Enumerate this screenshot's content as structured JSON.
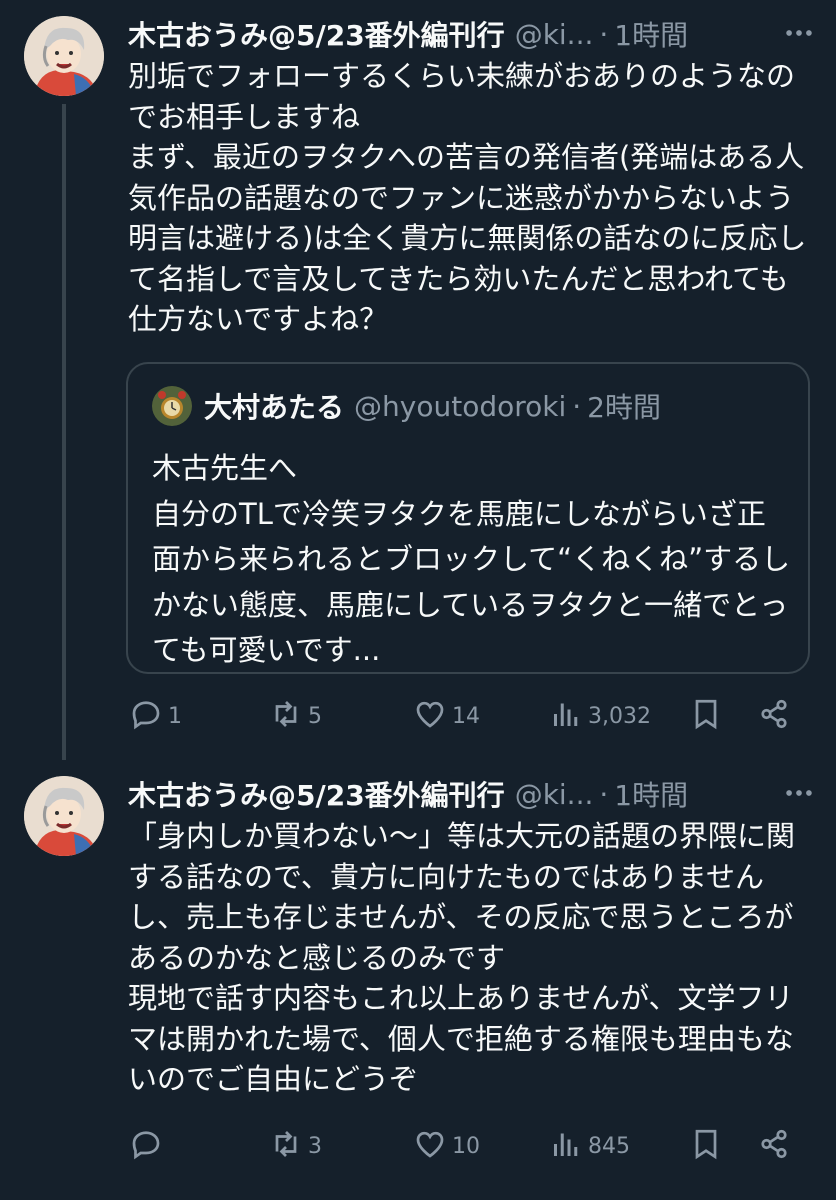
{
  "tweets": [
    {
      "author": {
        "display_name": "木古おうみ@5/23番外編刊行",
        "handle": "@ki...",
        "time": "1時間"
      },
      "text": "別垢でフォローするくらい未練がおありのようなのでお相手しますね\nまず、最近のヲタクへの苦言の発信者(発端はある人気作品の話題なのでファンに迷惑がかからないよう明言は避ける)は全く貴方に無関係の話なのに反応して名指しで言及してきたら効いたんだと思われても仕方ないですよね？",
      "quote": {
        "author": {
          "display_name": "大村あたる",
          "handle": "@hyoutodoroki",
          "time": "2時間"
        },
        "text": "木古先生へ\n自分のTLで冷笑ヲタクを馬鹿にしながらいざ正面から来られるとブロックして“くねくね”するしかない態度、馬鹿にしているヲタクと一緒でとっても可愛いです..."
      },
      "stats": {
        "replies": "1",
        "reposts": "5",
        "likes": "14",
        "views": "3,032"
      }
    },
    {
      "author": {
        "display_name": "木古おうみ@5/23番外編刊行",
        "handle": "@ki...",
        "time": "1時間"
      },
      "text": "「身内しか買わない〜」等は大元の話題の界隈に関する話なので、貴方に向けたものではありませんし、売上も存じませんが、その反応で思うところがあるのかなと感じるのみです\n現地で話す内容もこれ以上ありませんが、文学フリマは開かれた場で、個人で拒絶する権限も理由もないのでご自由にどうぞ",
      "stats": {
        "replies": "",
        "reposts": "3",
        "likes": "10",
        "views": "845"
      }
    }
  ],
  "separator": "·",
  "icons": {
    "more": "more-horizontal-icon",
    "reply": "reply-bubble-icon",
    "repost": "repost-arrows-icon",
    "like": "heart-icon",
    "views": "views-bar-chart-icon",
    "bookmark": "bookmark-icon",
    "share": "share-icon"
  },
  "colors": {
    "background": "#15202b",
    "text": "#f7f9f9",
    "secondary": "#8b98a5",
    "border": "#38444d"
  }
}
